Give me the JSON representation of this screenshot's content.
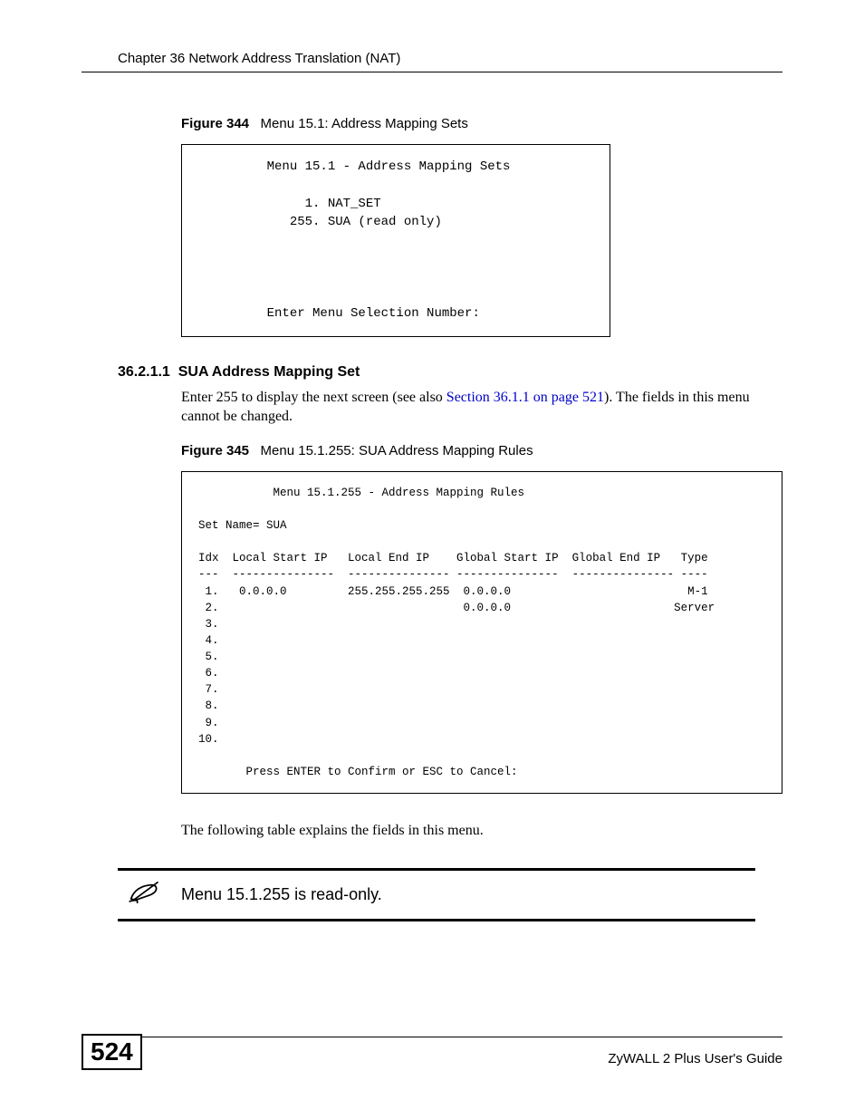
{
  "header": {
    "chapter": "Chapter 36 Network Address Translation (NAT)"
  },
  "figure344": {
    "label": "Figure 344",
    "caption": "Menu 15.1: Address Mapping Sets",
    "content": "         Menu 15.1 - Address Mapping Sets\n\n              1. NAT_SET\n            255. SUA (read only)\n\n\n\n\n         Enter Menu Selection Number:"
  },
  "section": {
    "number": "36.2.1.1",
    "title": "SUA Address Mapping Set",
    "paragraph_before": "Enter 255 to display the next screen (see also ",
    "link": "Section 36.1.1 on page 521",
    "paragraph_after": "). The fields in this menu cannot be changed."
  },
  "figure345": {
    "label": "Figure 345",
    "caption": "Menu 15.1.255: SUA Address Mapping Rules",
    "content": "           Menu 15.1.255 - Address Mapping Rules\n\nSet Name= SUA\n\nIdx  Local Start IP   Local End IP    Global Start IP  Global End IP   Type\n---  ---------------  --------------- ---------------  --------------- ----\n 1.   0.0.0.0         255.255.255.255  0.0.0.0                          M-1\n 2.                                    0.0.0.0                        Server\n 3.\n 4.\n 5.\n 6.\n 7.\n 8.\n 9.\n10.\n\n       Press ENTER to Confirm or ESC to Cancel:"
  },
  "explain_text": "The following table explains the fields in this menu.",
  "note": {
    "text": "Menu 15.1.255 is read-only."
  },
  "footer": {
    "page": "524",
    "guide": "ZyWALL 2 Plus User's Guide"
  }
}
